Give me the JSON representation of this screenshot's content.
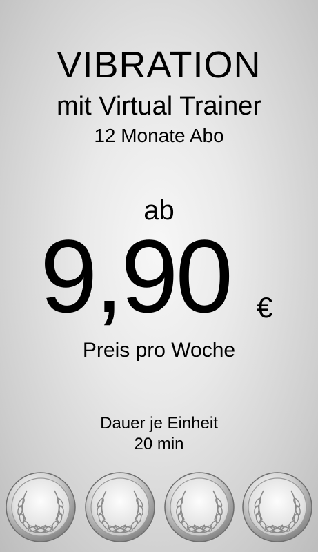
{
  "offer": {
    "title": "VIBRATION",
    "subtitle": "mit Virtual Trainer",
    "plan": "12 Monate Abo",
    "price_prefix": "ab",
    "price": "9,90",
    "currency": "€",
    "price_label": "Preis pro Woche",
    "duration_label": "Dauer je Einheit",
    "duration_value": "20 min"
  },
  "medals": [
    {
      "icon": "laurel-medal-icon"
    },
    {
      "icon": "laurel-medal-icon"
    },
    {
      "icon": "laurel-medal-icon"
    },
    {
      "icon": "laurel-medal-icon"
    }
  ],
  "colors": {
    "text": "#000000",
    "background_center": "#f7f7f7",
    "background_edge": "#bdbdbd",
    "medal_silver": "#c8c8c8"
  }
}
